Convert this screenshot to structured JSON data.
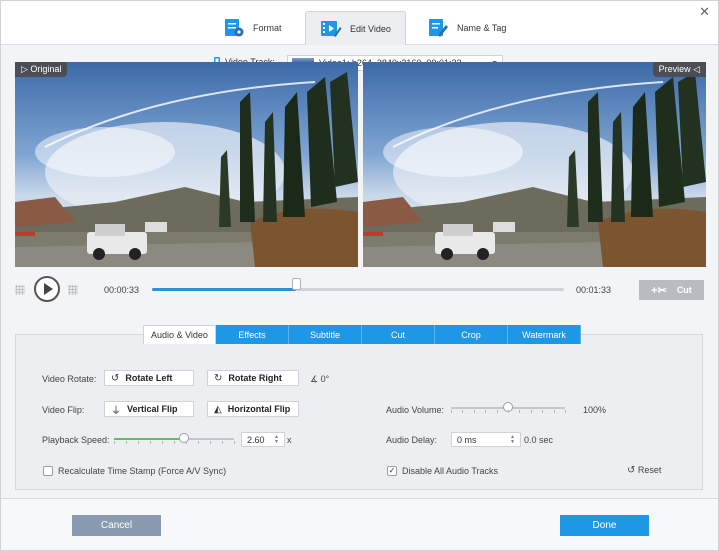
{
  "top_tabs": [
    {
      "label": "Format",
      "icon": "format-icon"
    },
    {
      "label": "Edit Video",
      "icon": "edit-video-icon"
    },
    {
      "label": "Name & Tag",
      "icon": "name-tag-icon"
    }
  ],
  "video_track": {
    "label": "Video Track:",
    "value": "Video1: h264, 3840x2160, 00:01:33"
  },
  "panes": {
    "original": "Original",
    "preview": "Preview"
  },
  "playback": {
    "current_time": "00:00:33",
    "total_time": "00:01:33",
    "progress": 0.35,
    "cut_label": "Cut"
  },
  "bottom_tabs": [
    "Audio & Video",
    "Effects",
    "Subtitle",
    "Cut",
    "Crop",
    "Watermark"
  ],
  "settings": {
    "rotate_label": "Video Rotate:",
    "rotate_left": "Rotate Left",
    "rotate_right": "Rotate Right",
    "rotate_angle": "0°",
    "flip_label": "Video Flip:",
    "vertical_flip": "Vertical Flip",
    "horizontal_flip": "Horizontal Flip",
    "speed_label": "Playback Speed:",
    "speed_value": "2.60",
    "speed_unit": "x",
    "speed_fraction": 0.58,
    "volume_label": "Audio Volume:",
    "volume_value": "100%",
    "volume_fraction": 0.5,
    "delay_label": "Audio Delay:",
    "delay_value": "0 ms",
    "delay_seconds": "0.0 sec",
    "recalc_label": "Recalculate Time Stamp (Force A/V Sync)",
    "recalc_checked": false,
    "disable_audio_label": "Disable All Audio Tracks",
    "disable_audio_checked": true,
    "reset_label": "Reset"
  },
  "footer": {
    "cancel": "Cancel",
    "done": "Done"
  },
  "colors": {
    "accent": "#1e98e6",
    "progress": "#2d8fd8",
    "speed_fill": "#5cc25c",
    "cancel_bg": "#8a9ab0"
  }
}
